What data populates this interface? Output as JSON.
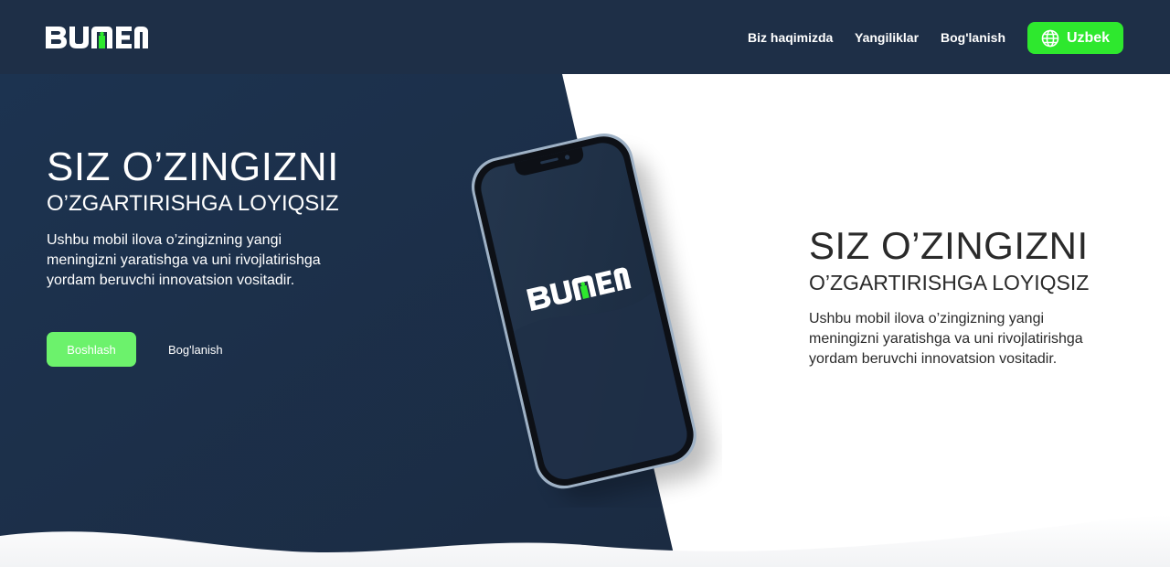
{
  "brand": {
    "logo_text": "BUMEN",
    "accent": "#2ee82e",
    "navy": "#1e2f47"
  },
  "nav": {
    "links": [
      "Biz haqimizda",
      "Yangiliklar",
      "Bog'lanish"
    ],
    "language_button": {
      "label": "Uzbek",
      "icon": "globe-icon"
    }
  },
  "hero": {
    "left": {
      "title": "SIZ O’ZINGIZNI",
      "subtitle": "O’ZGARTIRISHGA LOYIQSIZ",
      "description": "Ushbu mobil ilova o’zingizning yangi meningizni yaratishga va uni rivojlatirishga yordam beruvchi innovatsion vositadir.",
      "primary_button": "Boshlash",
      "secondary_link": "Bog'lanish"
    },
    "right": {
      "title": "SIZ O’ZINGIZNI",
      "subtitle": "O’ZGARTIRISHGA LOYIQSIZ",
      "description": "Ushbu mobil ilova o’zingizning yangi meningizni yaratishga va uni rivojlatirishga yordam beruvchi innovatsion vositadir."
    },
    "phone_screen_logo": "BUMEN"
  }
}
